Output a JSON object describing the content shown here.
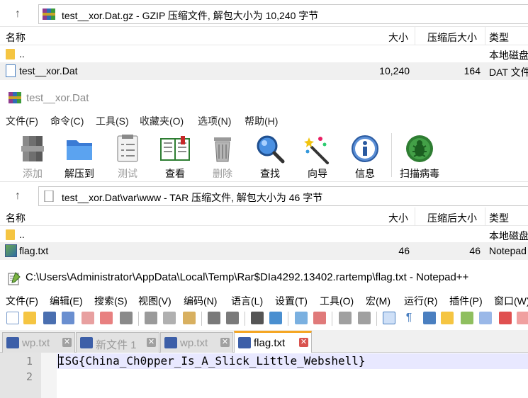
{
  "archive1": {
    "path": "test__xor.Dat.gz - GZIP 压缩文件, 解包大小为 10,240 字节",
    "columns": {
      "name": "名称",
      "size": "大小",
      "packed": "压缩后大小",
      "type": "类型"
    },
    "rows": [
      {
        "name": "..",
        "size": "",
        "packed": "",
        "type": "本地磁盘"
      },
      {
        "name": "test__xor.Dat",
        "size": "10,240",
        "packed": "164",
        "type": "DAT 文件"
      }
    ]
  },
  "winrar2": {
    "title": "test__xor.Dat",
    "menu": [
      "文件(F)",
      "命令(C)",
      "工具(S)",
      "收藏夹(O)",
      "选项(N)",
      "帮助(H)"
    ],
    "toolbar": [
      {
        "label": "添加",
        "icon": "add-archive-icon",
        "disabled": true
      },
      {
        "label": "解压到",
        "icon": "extract-to-icon",
        "disabled": false
      },
      {
        "label": "测试",
        "icon": "test-icon",
        "disabled": true
      },
      {
        "label": "查看",
        "icon": "view-book-icon",
        "disabled": false
      },
      {
        "label": "删除",
        "icon": "trash-icon",
        "disabled": true
      },
      {
        "label": "查找",
        "icon": "magnifier-icon",
        "disabled": false
      },
      {
        "label": "向导",
        "icon": "wizard-wand-icon",
        "disabled": false
      },
      {
        "label": "信息",
        "icon": "info-icon",
        "disabled": false
      },
      {
        "label": "扫描病毒",
        "icon": "virus-scan-icon",
        "disabled": false
      }
    ]
  },
  "archive2": {
    "path": "test__xor.Dat\\var\\www - TAR 压缩文件, 解包大小为 46 字节",
    "columns": {
      "name": "名称",
      "size": "大小",
      "packed": "压缩后大小",
      "type": "类型"
    },
    "rows": [
      {
        "name": "..",
        "size": "",
        "packed": "",
        "type": "本地磁盘"
      },
      {
        "name": "flag.txt",
        "size": "46",
        "packed": "46",
        "type": "Notepad"
      }
    ]
  },
  "notepad": {
    "title": "C:\\Users\\Administrator\\AppData\\Local\\Temp\\Rar$DIa4292.13402.rartemp\\flag.txt - Notepad++",
    "menu": [
      "文件(F)",
      "编辑(E)",
      "搜索(S)",
      "视图(V)",
      "编码(N)",
      "语言(L)",
      "设置(T)",
      "工具(O)",
      "宏(M)",
      "运行(R)",
      "插件(P)",
      "窗口(W)"
    ],
    "tabs": [
      {
        "label": "wp.txt",
        "active": false,
        "unsaved": false
      },
      {
        "label": "新文件 1",
        "active": false,
        "unsaved": true
      },
      {
        "label": "wp.txt",
        "active": false,
        "unsaved": false
      },
      {
        "label": "flag.txt",
        "active": true,
        "unsaved": false
      }
    ],
    "line_numbers": [
      "1",
      "2"
    ],
    "content": "ISG{China_Ch0pper_Is_A_Slick_Little_Webshell}"
  },
  "colors": {
    "accent_tab": "#f5a623",
    "current_line": "#e8e8ff",
    "selected_row": "#f0f0f0"
  }
}
